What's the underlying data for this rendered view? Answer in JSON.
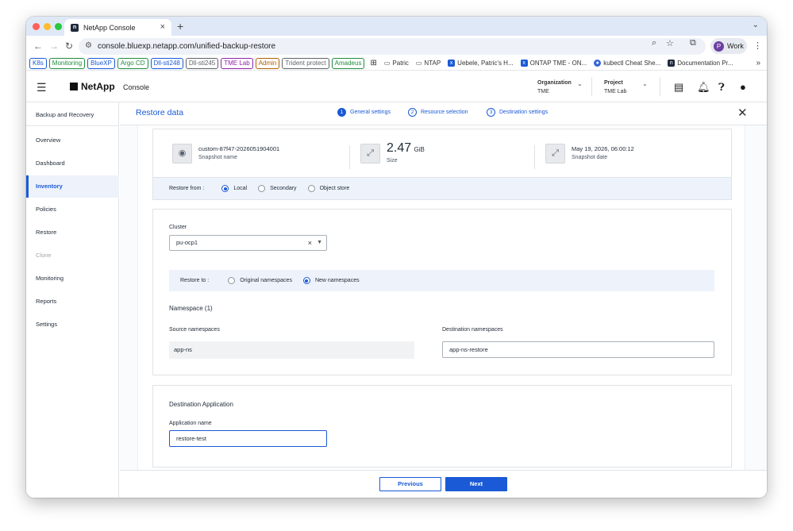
{
  "browser": {
    "tab_title": "NetApp Console",
    "url": "console.bluexp.netapp.com/unified-backup-restore",
    "profile_label": "Work",
    "profile_initial": "P",
    "bookmark_chips": [
      {
        "label": "K8s",
        "color": "#1a5ad6"
      },
      {
        "label": "Monitoring",
        "color": "#1e8e3e"
      },
      {
        "label": "BlueXP",
        "color": "#1a5ad6"
      },
      {
        "label": "Argo CD",
        "color": "#1e8e3e"
      },
      {
        "label": "Dll-sti248",
        "color": "#1a5ad6"
      },
      {
        "label": "Dll-sti245",
        "color": "#5f6368"
      },
      {
        "label": "TME Lab",
        "color": "#8e24aa"
      },
      {
        "label": "Admin",
        "color": "#b06000"
      },
      {
        "label": "Trident protect",
        "color": "#5f6368"
      },
      {
        "label": "Amadeus",
        "color": "#1e8e3e"
      }
    ],
    "bookmark_links": [
      "Patric",
      "NTAP",
      "Uebele, Patric's H...",
      "ONTAP TME - ON...",
      "kubectl Cheat She...",
      "Documentation Pr..."
    ]
  },
  "header": {
    "logo": "NetApp",
    "console_label": "Console",
    "organization_label": "Organization",
    "organization_value": "TME",
    "project_label": "Project",
    "project_value": "TME Lab"
  },
  "sidebar": {
    "title": "Backup and Recovery",
    "items": [
      {
        "label": "Overview",
        "state": "normal"
      },
      {
        "label": "Dashboard",
        "state": "normal"
      },
      {
        "label": "Inventory",
        "state": "active"
      },
      {
        "label": "Policies",
        "state": "normal"
      },
      {
        "label": "Restore",
        "state": "normal"
      },
      {
        "label": "Clone",
        "state": "disabled"
      },
      {
        "label": "Monitoring",
        "state": "normal"
      },
      {
        "label": "Reports",
        "state": "normal"
      },
      {
        "label": "Settings",
        "state": "normal"
      }
    ]
  },
  "wizard": {
    "title": "Restore data",
    "steps": [
      {
        "num": "1",
        "label": "General settings"
      },
      {
        "num": "2",
        "label": "Resource selection"
      },
      {
        "num": "3",
        "label": "Destination settings"
      }
    ]
  },
  "snapshot": {
    "name_value": "custom-87f47-2026051904001",
    "name_label": "Snapshot name",
    "size_value": "2.47",
    "size_unit": "GiB",
    "size_label": "Size",
    "date_value": "May 19, 2026, 06:00:12",
    "date_label": "Snapshot date"
  },
  "restore_from": {
    "label": "Restore from :",
    "options": [
      {
        "label": "Local",
        "selected": true
      },
      {
        "label": "Secondary",
        "selected": false
      },
      {
        "label": "Object store",
        "selected": false
      }
    ]
  },
  "cluster": {
    "label": "Cluster",
    "value": "pu-ocp1"
  },
  "restore_to": {
    "label": "Restore to :",
    "options": [
      {
        "label": "Original namespaces",
        "selected": false
      },
      {
        "label": "New namespaces",
        "selected": true
      }
    ]
  },
  "namespace": {
    "title": "Namespace (1)",
    "source_label": "Source namespaces",
    "source_value": "app-ns",
    "dest_label": "Destination namespaces",
    "dest_value": "app-ns-restore"
  },
  "destination_app": {
    "title": "Destination Application",
    "name_label": "Application name",
    "name_value": "restore-test"
  },
  "footer": {
    "previous_label": "Previous",
    "next_label": "Next"
  },
  "colors": {
    "accent": "#1a5ad6",
    "light_band": "#eef3fb"
  }
}
